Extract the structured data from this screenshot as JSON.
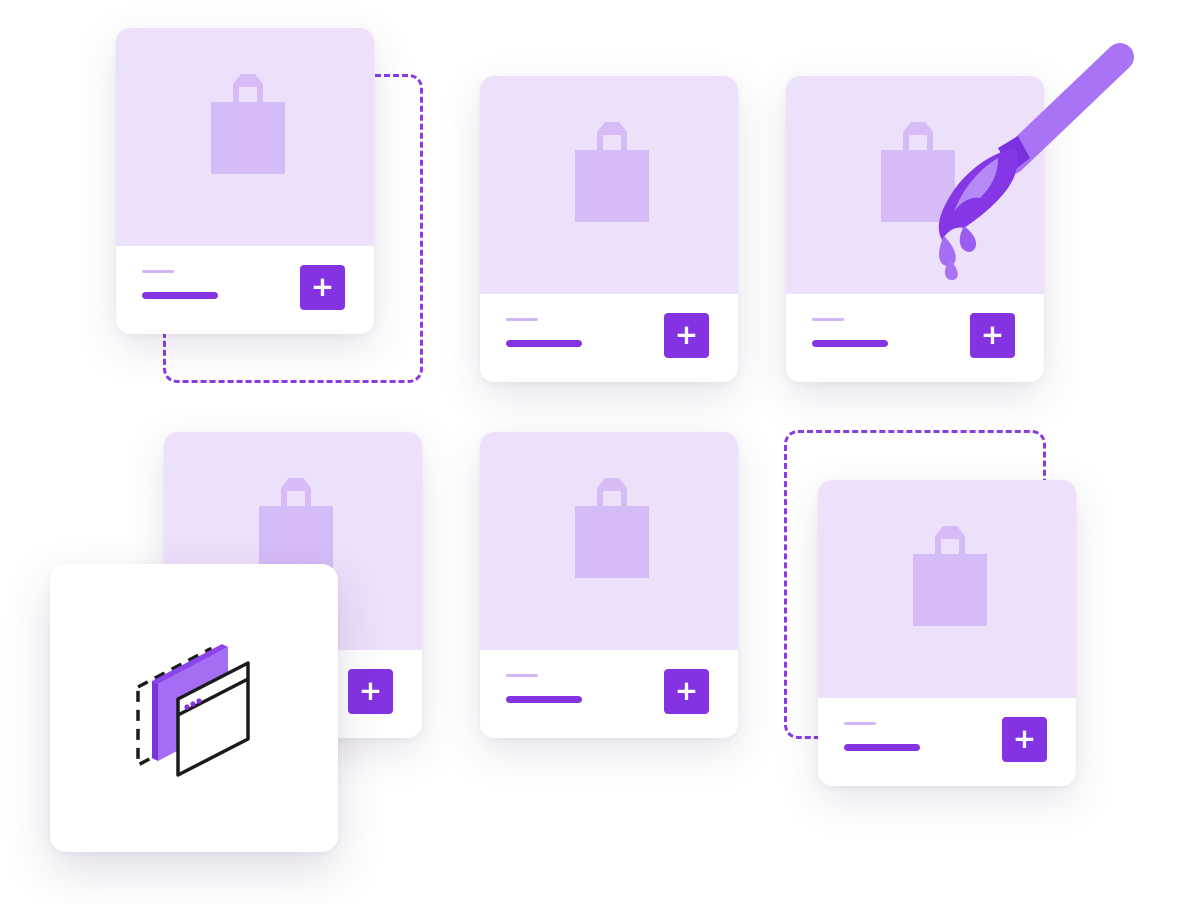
{
  "colors": {
    "accent": "#8333e2",
    "card_image_bg": "#ede0fb",
    "bag_fill": "#d5bcf6",
    "muted_line": "#d2b6f5",
    "dashed_frame": "#8a3be6"
  },
  "cards": [
    {
      "icon": "shopping-bag-icon",
      "button_label": "+"
    },
    {
      "icon": "shopping-bag-icon",
      "button_label": "+"
    },
    {
      "icon": "shopping-bag-icon",
      "button_label": "+"
    },
    {
      "icon": "shopping-bag-icon",
      "button_label": "+"
    },
    {
      "icon": "shopping-bag-icon",
      "button_label": "+"
    },
    {
      "icon": "shopping-bag-icon",
      "button_label": "+"
    }
  ],
  "overlay_tile": {
    "icon": "layered-browser-window-icon"
  },
  "decoration": {
    "icon": "paint-brush-icon"
  }
}
